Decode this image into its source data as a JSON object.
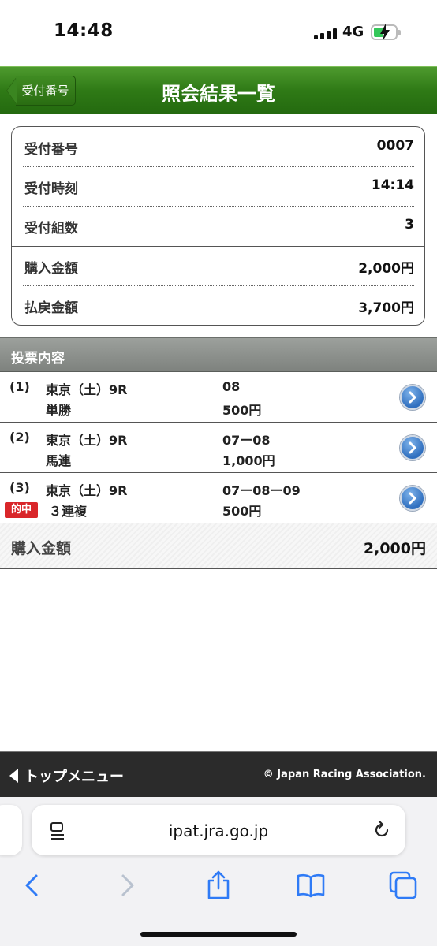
{
  "status_bar": {
    "time": "14:48",
    "network": "4G"
  },
  "header": {
    "title": "照会結果一覧",
    "back_label": "受付番号"
  },
  "summary": {
    "rows": [
      {
        "label": "受付番号",
        "value": "0007"
      },
      {
        "label": "受付時刻",
        "value": "14:14"
      },
      {
        "label": "受付組数",
        "value": "3"
      },
      {
        "label": "購入金額",
        "value": "2,000円"
      },
      {
        "label": "払戻金額",
        "value": "3,700円"
      }
    ]
  },
  "section": {
    "title": "投票内容"
  },
  "bets": [
    {
      "num": "(1)",
      "race": "東京（土）9R",
      "type": "単勝",
      "combo": "08",
      "amount": "500円",
      "hit": ""
    },
    {
      "num": "(2)",
      "race": "東京（土）9R",
      "type": "馬連",
      "combo": "07ー08",
      "amount": "1,000円",
      "hit": ""
    },
    {
      "num": "(3)",
      "race": "東京（土）9R",
      "type": "３連複",
      "combo": "07ー08ー09",
      "amount": "500円",
      "hit": "的中"
    }
  ],
  "total": {
    "label": "購入金額",
    "value": "2,000円"
  },
  "footer": {
    "menu_label": "トップメニュー",
    "copyright": "© Japan Racing Association."
  },
  "browser": {
    "url": "ipat.jra.go.jp"
  },
  "colors": {
    "header_green": "#2f7a16",
    "hit_red": "#d9262a",
    "arrow_blue": "#2f6fbf"
  }
}
